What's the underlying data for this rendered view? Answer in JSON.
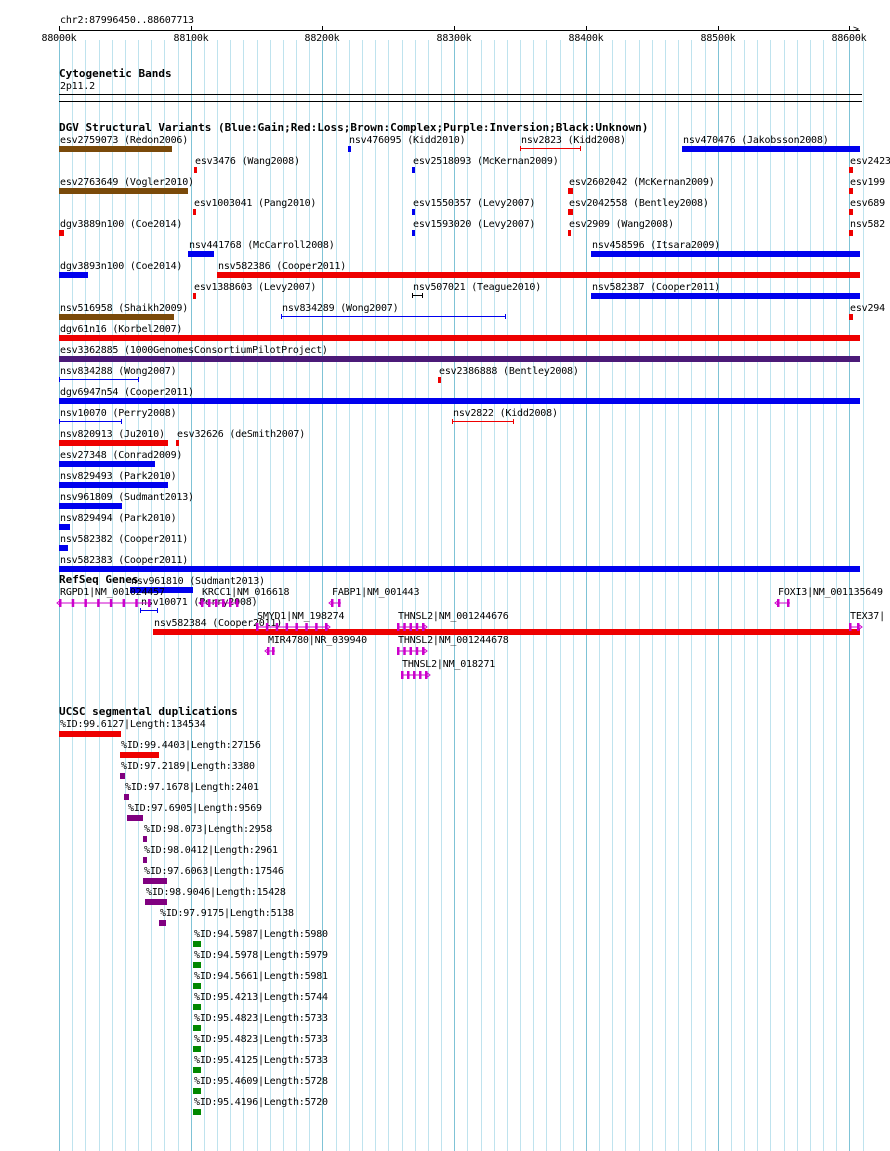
{
  "ruler": {
    "range_label": "chr2:87996450..88607713",
    "ticks": [
      "88000k",
      "88100k",
      "88200k",
      "88300k",
      "88400k",
      "88500k",
      "88600k"
    ]
  },
  "cyto": {
    "title": "Cytogenetic Bands",
    "band": "2p11.2"
  },
  "dgv": {
    "title": "DGV Structural Variants (Blue:Gain;Red:Loss;Brown:Complex;Purple:Inversion;Black:Unknown)",
    "colors": {
      "gain": "#0000ee",
      "loss": "#ee0000",
      "complex": "#7a4a0a",
      "inversion": "#4b1a78",
      "unknown": "#000000"
    },
    "items": [
      {
        "label": "esv2759073 (Redon2006)",
        "start": 88000000,
        "end": 88086000,
        "color": "complex",
        "style": "bar"
      },
      {
        "label": "esv3476 (Wang2008)",
        "start": 88103000,
        "end": 88104000,
        "color": "loss",
        "style": "bar"
      },
      {
        "label": "nsv476095 (Kidd2010)",
        "start": 88220000,
        "end": 88221000,
        "color": "gain",
        "style": "bar"
      },
      {
        "label": "nsv2823 (Kidd2008)",
        "start": 88350000,
        "end": 88396000,
        "color": "loss",
        "style": "interval"
      },
      {
        "label": "nsv470476 (Jakobsson2008)",
        "start": 88473000,
        "end": 88608000,
        "color": "gain",
        "style": "bar"
      },
      {
        "label": "esv2763649 (Vogler2010)",
        "start": 88000000,
        "end": 88098000,
        "color": "complex",
        "style": "bar"
      },
      {
        "label": "esv1003041 (Pang2010)",
        "start": 88102000,
        "end": 88104000,
        "color": "loss",
        "style": "bar"
      },
      {
        "label": "esv2518093 (McKernan2009)",
        "start": 88268000,
        "end": 88270000,
        "color": "gain",
        "style": "bar"
      },
      {
        "label": "esv2602042 (McKernan2009)",
        "start": 88387000,
        "end": 88390000,
        "color": "loss",
        "style": "bar"
      },
      {
        "label": "esv2423",
        "start": 88600000,
        "end": 88603000,
        "color": "loss",
        "style": "bar"
      },
      {
        "label": "dgv3889n100 (Coe2014)",
        "start": 88000000,
        "end": 88004000,
        "color": "loss",
        "style": "bar"
      },
      {
        "label": "nsv441768 (McCarroll2008)",
        "start": 88098000,
        "end": 88118000,
        "color": "gain",
        "style": "bar"
      },
      {
        "label": "esv1550357 (Levy2007)",
        "start": 88268000,
        "end": 88270000,
        "color": "gain",
        "style": "bar"
      },
      {
        "label": "esv2042558 (Bentley2008)",
        "start": 88387000,
        "end": 88390000,
        "color": "loss",
        "style": "bar"
      },
      {
        "label": "esv199",
        "start": 88600000,
        "end": 88603000,
        "color": "loss",
        "style": "bar"
      },
      {
        "label": "dgv3893n100 (Coe2014)",
        "start": 88000000,
        "end": 88022000,
        "color": "gain",
        "style": "bar"
      },
      {
        "label": "esv1388603 (Levy2007)",
        "start": 88102000,
        "end": 88104000,
        "color": "loss",
        "style": "bar"
      },
      {
        "label": "esv1593020 (Levy2007)",
        "start": 88268000,
        "end": 88270000,
        "color": "gain",
        "style": "bar"
      },
      {
        "label": "esv2909 (Wang2008)",
        "start": 88387000,
        "end": 88389000,
        "color": "loss",
        "style": "bar"
      },
      {
        "label": "esv689",
        "start": 88600000,
        "end": 88603000,
        "color": "loss",
        "style": "bar"
      },
      {
        "label": "nsv516958 (Shaikh2009)",
        "start": 88000000,
        "end": 88087000,
        "color": "complex",
        "style": "bar"
      },
      {
        "label": "nsv582386 (Cooper2011)",
        "start": 88120000,
        "end": 88608000,
        "color": "loss",
        "style": "bar"
      },
      {
        "label": "dgv61n16 (Korbel2007)",
        "start": 88000000,
        "end": 88608000,
        "color": "loss",
        "style": "bar"
      },
      {
        "label": "esv3362885 (1000GenomesConsortiumPilotProject)",
        "start": 88000000,
        "end": 88608000,
        "color": "inversion",
        "style": "bar"
      },
      {
        "label": "nsv834288 (Wong2007)",
        "start": 88000000,
        "end": 88061000,
        "color": "gain",
        "style": "interval"
      },
      {
        "label": "nsv834289 (Wong2007)",
        "start": 88169000,
        "end": 88339000,
        "color": "gain",
        "style": "interval"
      },
      {
        "label": "nsv458596 (Itsara2009)",
        "start": 88404000,
        "end": 88608000,
        "color": "gain",
        "style": "bar"
      },
      {
        "label": "dgv6947n54 (Cooper2011)",
        "start": 88000000,
        "end": 88608000,
        "color": "gain",
        "style": "bar"
      },
      {
        "label": "nsv10070 (Perry2008)",
        "start": 88000000,
        "end": 88048000,
        "color": "gain",
        "style": "interval"
      },
      {
        "label": "nsv507021 (Teague2010)",
        "start": 88268000,
        "end": 88276000,
        "color": "unknown",
        "style": "interval"
      },
      {
        "label": "nsv582387 (Cooper2011)",
        "start": 88404000,
        "end": 88608000,
        "color": "gain",
        "style": "bar"
      },
      {
        "label": "nsv820913 (Ju2010)",
        "start": 88000000,
        "end": 88083000,
        "color": "loss",
        "style": "bar"
      },
      {
        "label": "esv32626 (deSmith2007)",
        "start": 88089000,
        "end": 88091000,
        "color": "loss",
        "style": "bar"
      },
      {
        "label": "esv2386888 (Bentley2008)",
        "start": 88288000,
        "end": 88290000,
        "color": "loss",
        "style": "bar"
      },
      {
        "label": "nsv582",
        "start": 88600000,
        "end": 88603000,
        "color": "loss",
        "style": "bar"
      },
      {
        "label": "esv27348 (Conrad2009)",
        "start": 88000000,
        "end": 88073000,
        "color": "gain",
        "style": "bar"
      },
      {
        "label": "nsv2822 (Kidd2008)",
        "start": 88299000,
        "end": 88345000,
        "color": "loss",
        "style": "interval"
      },
      {
        "label": "esv294",
        "start": 88600000,
        "end": 88603000,
        "color": "loss",
        "style": "bar"
      },
      {
        "label": "nsv829493 (Park2010)",
        "start": 88000000,
        "end": 88083000,
        "color": "gain",
        "style": "bar"
      },
      {
        "label": "nsv961809 (Sudmant2013)",
        "start": 88000000,
        "end": 88048000,
        "color": "gain",
        "style": "bar"
      },
      {
        "label": "nsv829494 (Park2010)",
        "start": 88000000,
        "end": 88008000,
        "color": "gain",
        "style": "bar"
      },
      {
        "label": "nsv582382 (Cooper2011)",
        "start": 88000000,
        "end": 88007000,
        "color": "gain",
        "style": "bar"
      },
      {
        "label": "nsv582383 (Cooper2011)",
        "start": 88000000,
        "end": 88608000,
        "color": "gain",
        "style": "bar"
      },
      {
        "label": "nsv961810 (Sudmant2013)",
        "start": 88054000,
        "end": 88102000,
        "color": "gain",
        "style": "bar"
      },
      {
        "label": "nsv10071 (Perry2008)",
        "start": 88062000,
        "end": 88075000,
        "color": "gain",
        "style": "interval"
      },
      {
        "label": "nsv582384 (Cooper2011)",
        "start": 88072000,
        "end": 88608000,
        "color": "loss",
        "style": "bar"
      }
    ]
  },
  "refseq": {
    "title": "RefSeq Genes",
    "color": "#cc00cc",
    "genes": [
      {
        "label": "RGPD1|NM_001024457",
        "start": 88000000,
        "end": 88070000,
        "strand": "-"
      },
      {
        "label": "KRCC1|NM_016618",
        "start": 88108000,
        "end": 88137000,
        "strand": "-"
      },
      {
        "label": "FABP1|NM_001443",
        "start": 88207000,
        "end": 88214000,
        "strand": "-"
      },
      {
        "label": "SMYD1|NM_198274",
        "start": 88150000,
        "end": 88204000,
        "strand": "+"
      },
      {
        "label": "MIR4780|NR_039940",
        "start": 88158000,
        "end": 88164000,
        "strand": "-"
      },
      {
        "label": "THNSL2|NM_001244676",
        "start": 88257000,
        "end": 88278000,
        "strand": "+"
      },
      {
        "label": "THNSL2|NM_001244678",
        "start": 88257000,
        "end": 88278000,
        "strand": "+"
      },
      {
        "label": "THNSL2|NM_018271",
        "start": 88260000,
        "end": 88280000,
        "strand": "+"
      },
      {
        "label": "FOXI3|NM_001135649",
        "start": 88545000,
        "end": 88555000,
        "strand": "-"
      },
      {
        "label": "TEX37|",
        "start": 88600000,
        "end": 88608000,
        "strand": "+"
      }
    ]
  },
  "segdup": {
    "title": "UCSC segmental duplications",
    "colors": {
      "red": "#ee0000",
      "purple": "#800080",
      "green": "#008800"
    },
    "items": [
      {
        "label": "%ID:99.6127|Length:134534",
        "start": 88000000,
        "end": 88047000,
        "color": "red"
      },
      {
        "label": "%ID:99.4403|Length:27156",
        "start": 88047000,
        "end": 88076000,
        "color": "red"
      },
      {
        "label": "%ID:97.2189|Length:3380",
        "start": 88047000,
        "end": 88050000,
        "color": "purple"
      },
      {
        "label": "%ID:97.1678|Length:2401",
        "start": 88050000,
        "end": 88053000,
        "color": "purple"
      },
      {
        "label": "%ID:97.6905|Length:9569",
        "start": 88052000,
        "end": 88064000,
        "color": "purple"
      },
      {
        "label": "%ID:98.073|Length:2958",
        "start": 88064000,
        "end": 88067000,
        "color": "purple"
      },
      {
        "label": "%ID:98.0412|Length:2961",
        "start": 88064000,
        "end": 88067000,
        "color": "purple"
      },
      {
        "label": "%ID:97.6063|Length:17546",
        "start": 88064000,
        "end": 88082000,
        "color": "purple"
      },
      {
        "label": "%ID:98.9046|Length:15428",
        "start": 88066000,
        "end": 88082000,
        "color": "purple"
      },
      {
        "label": "%ID:97.9175|Length:5138",
        "start": 88076000,
        "end": 88081000,
        "color": "purple"
      },
      {
        "label": "%ID:94.5987|Length:5980",
        "start": 88102000,
        "end": 88108000,
        "color": "green"
      },
      {
        "label": "%ID:94.5978|Length:5979",
        "start": 88102000,
        "end": 88108000,
        "color": "green"
      },
      {
        "label": "%ID:94.5661|Length:5981",
        "start": 88102000,
        "end": 88108000,
        "color": "green"
      },
      {
        "label": "%ID:95.4213|Length:5744",
        "start": 88102000,
        "end": 88108000,
        "color": "green"
      },
      {
        "label": "%ID:95.4823|Length:5733",
        "start": 88102000,
        "end": 88108000,
        "color": "green"
      },
      {
        "label": "%ID:95.4823|Length:5733",
        "start": 88102000,
        "end": 88108000,
        "color": "green"
      },
      {
        "label": "%ID:95.4125|Length:5733",
        "start": 88102000,
        "end": 88108000,
        "color": "green"
      },
      {
        "label": "%ID:95.4609|Length:5728",
        "start": 88102000,
        "end": 88108000,
        "color": "green"
      },
      {
        "label": "%ID:95.4196|Length:5720",
        "start": 88102000,
        "end": 88108000,
        "color": "green"
      }
    ]
  }
}
